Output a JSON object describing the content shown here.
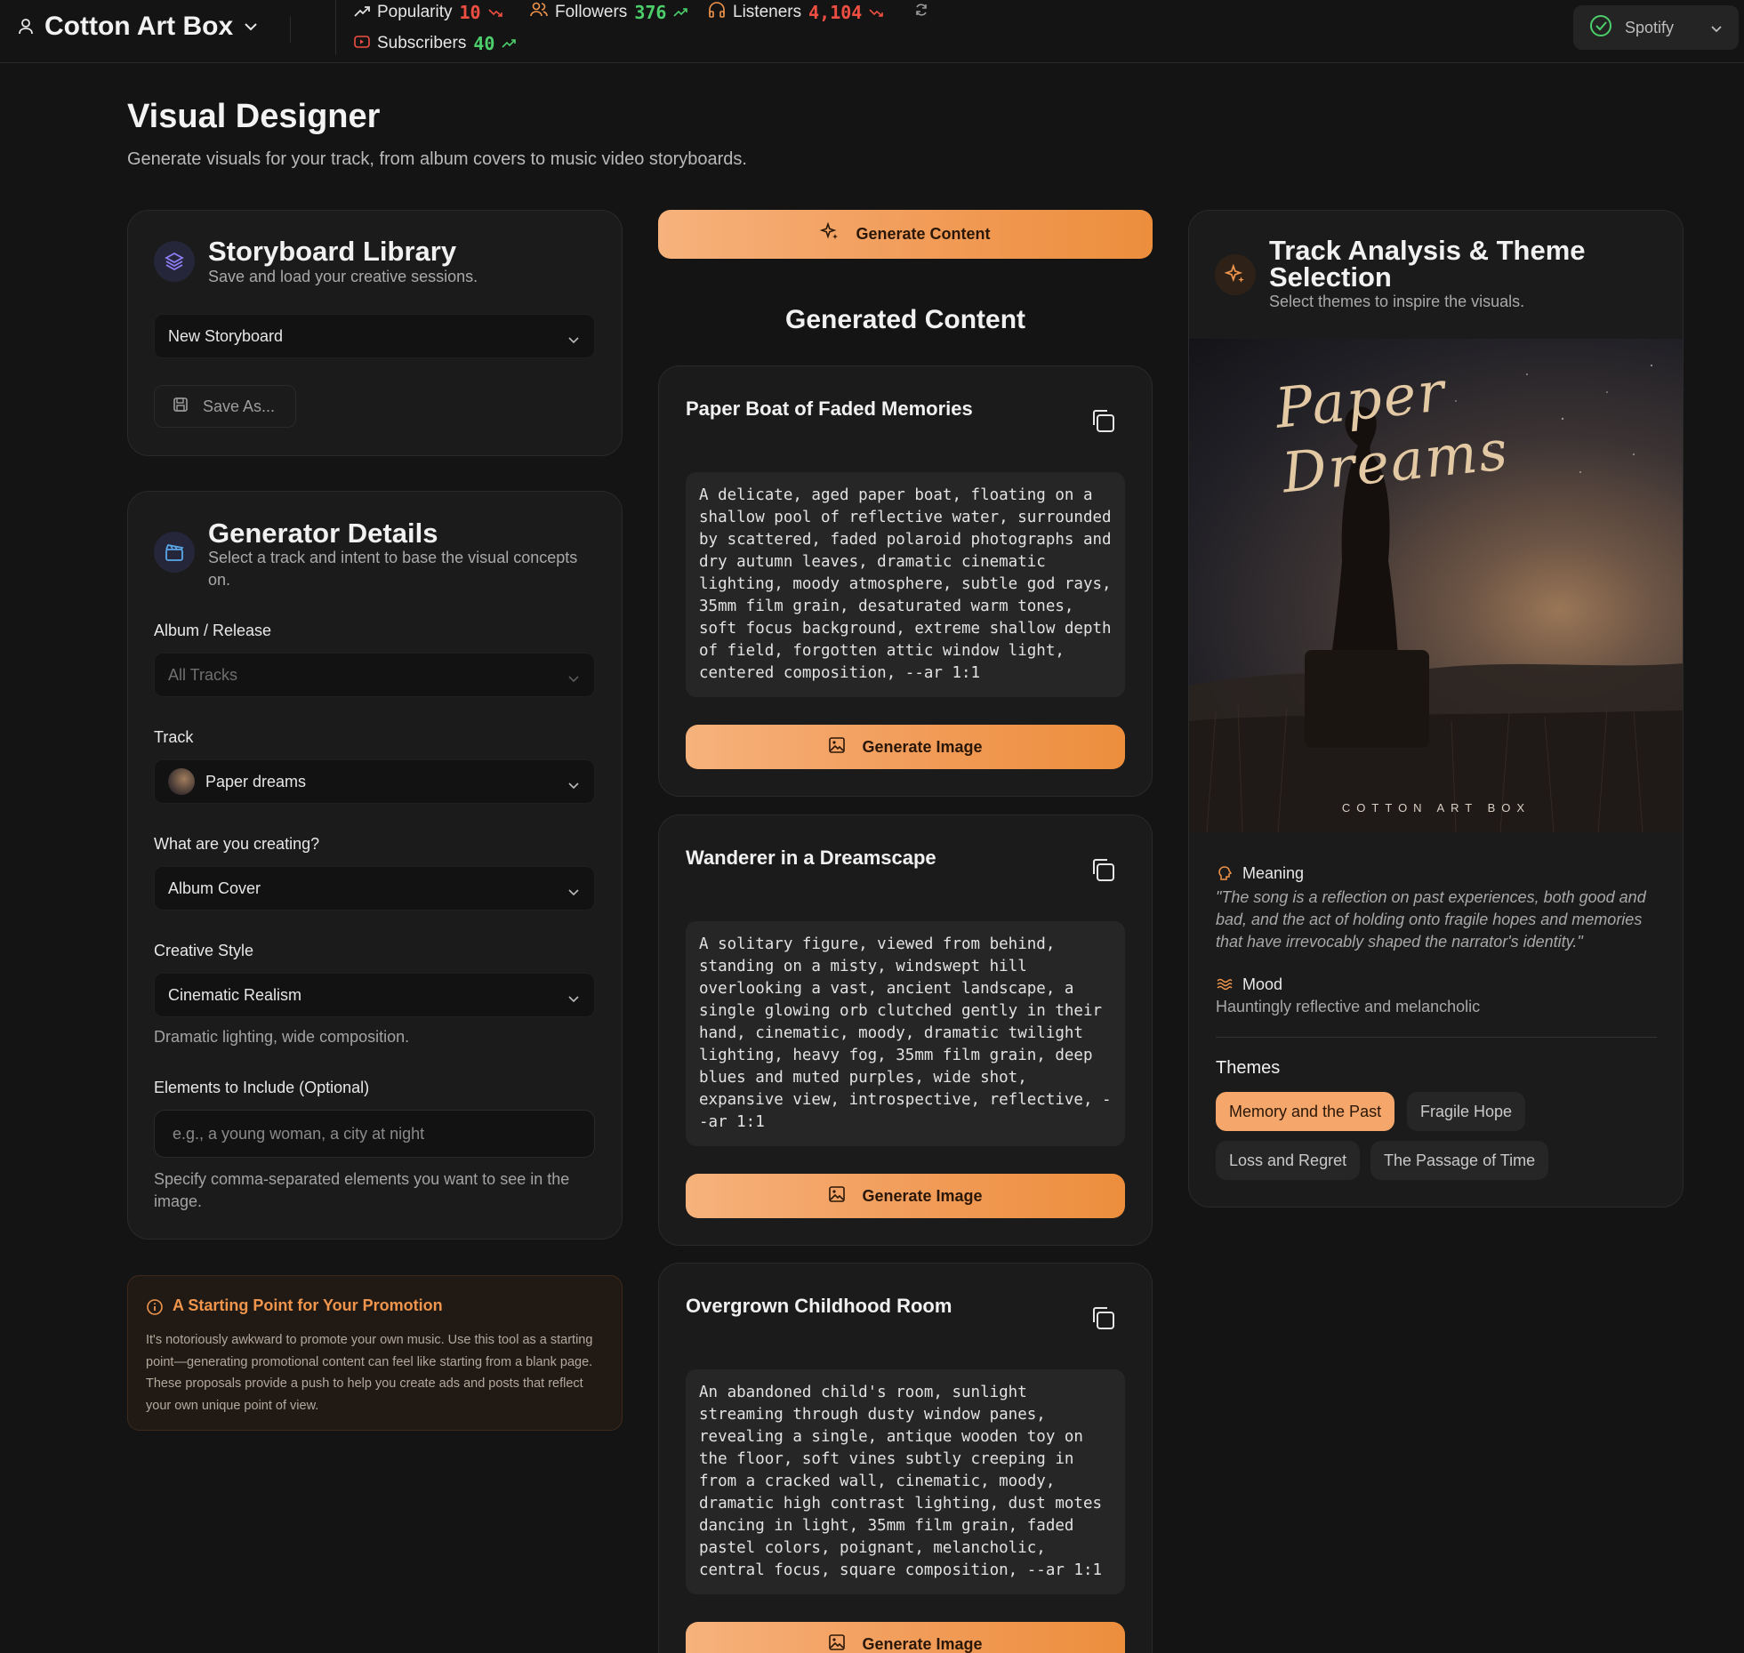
{
  "topbar": {
    "account_name": "Cotton Art Box",
    "stats": [
      {
        "label": "Popularity",
        "value": "10"
      },
      {
        "label": "Followers",
        "value": "376"
      },
      {
        "label": "Listeners",
        "value": "4,104"
      },
      {
        "label": "Subscribers",
        "value": "40"
      }
    ],
    "platform": "Spotify"
  },
  "page": {
    "title": "Visual Designer",
    "subtitle": "Generate visuals for your track, from album covers to music video storyboards."
  },
  "library": {
    "title": "Storyboard Library",
    "subtitle": "Save and load your creative sessions.",
    "selected": "New Storyboard",
    "save_label": "Save As..."
  },
  "generator": {
    "title": "Generator Details",
    "subtitle": "Select a track and intent to base the visual concepts on.",
    "album_label": "Album / Release",
    "album_value": "All Tracks",
    "track_label": "Track",
    "track_value": "Paper dreams",
    "creating_label": "What are you creating?",
    "creating_value": "Album Cover",
    "style_label": "Creative Style",
    "style_value": "Cinematic Realism",
    "style_hint": "Dramatic lighting, wide composition.",
    "elements_label": "Elements to Include (Optional)",
    "elements_placeholder": "e.g., a young woman, a city at night",
    "elements_hint": "Specify comma-separated elements you want to see in the image."
  },
  "notice": {
    "title": "A Starting Point for Your Promotion",
    "body": "It's notoriously awkward to promote your own music. Use this tool as a starting point—generating promotional content can feel like starting from a blank page. These proposals provide a push to help you create ads and posts that reflect your own unique point of view."
  },
  "middle": {
    "generate_label": "Generate Content",
    "heading": "Generated Content",
    "generate_image_label": "Generate Image",
    "items": [
      {
        "title": "Paper Boat of Faded Memories",
        "prompt": "A delicate, aged paper boat, floating on a\nshallow pool of reflective water, surrounded\nby scattered, faded polaroid photographs and\ndry autumn leaves, dramatic cinematic\nlighting, moody atmosphere, subtle god rays,\n35mm film grain, desaturated warm tones,\nsoft focus background, extreme shallow depth\nof field, forgotten attic window light,\ncentered composition, --ar 1:1"
      },
      {
        "title": "Wanderer in a Dreamscape",
        "prompt": "A solitary figure, viewed from behind,\nstanding on a misty, windswept hill\noverlooking a vast, ancient landscape, a\nsingle glowing orb clutched gently in their\nhand, cinematic, moody, dramatic twilight\nlighting, heavy fog, 35mm film grain, deep\nblues and muted purples, wide shot,\nexpansive view, introspective, reflective, -\n-ar 1:1"
      },
      {
        "title": "Overgrown Childhood Room",
        "prompt": "An abandoned child's room, sunlight\nstreaming through dusty window panes,\nrevealing a single, antique wooden toy on\nthe floor, soft vines subtly creeping in\nfrom a cracked wall, cinematic, moody,\ndramatic high contrast lighting, dust motes\ndancing in light, 35mm film grain, faded\npastel colors, poignant, melancholic,\ncentral focus, square composition, --ar 1:1"
      }
    ]
  },
  "analysis": {
    "title": "Track Analysis & Theme Selection",
    "subtitle": "Select themes to inspire the visuals.",
    "cover_title": "Paper Dreams",
    "cover_brand": "COTTON ART BOX",
    "meaning_label": "Meaning",
    "meaning_text": "\"The song is a reflection on past experiences, both good and bad, and the act of holding onto fragile hopes and memories that have irrevocably shaped the narrator's identity.\"",
    "mood_label": "Mood",
    "mood_text": "Hauntingly reflective and melancholic",
    "themes_label": "Themes",
    "themes": [
      {
        "label": "Memory and the Past",
        "selected": true
      },
      {
        "label": "Fragile Hope",
        "selected": false
      },
      {
        "label": "Loss and Regret",
        "selected": false
      },
      {
        "label": "The Passage of Time",
        "selected": false
      }
    ]
  },
  "colors": {
    "accent": "#f29d5b",
    "background": "#141414",
    "card": "#1b1b1b",
    "positive": "#4ccf6b",
    "negative": "#ef4f43"
  }
}
